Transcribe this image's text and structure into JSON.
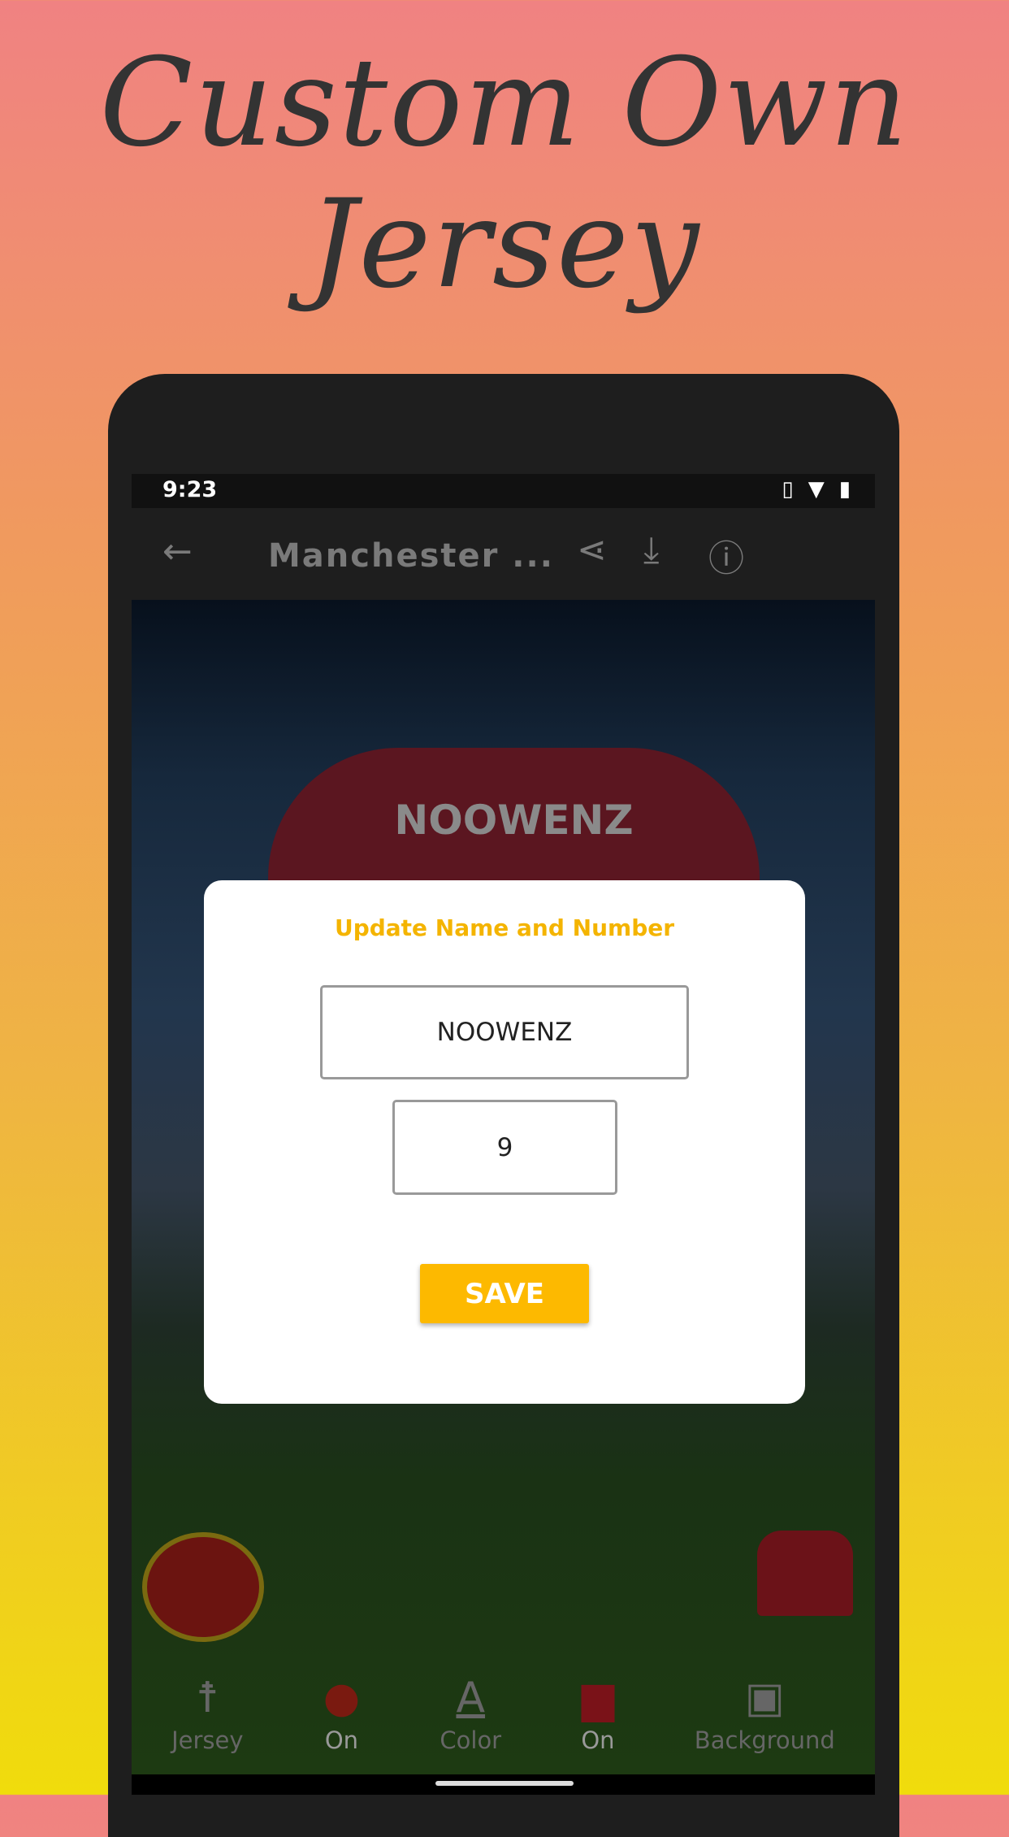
{
  "promo": {
    "headline": "Custom Own Jersey"
  },
  "status_bar": {
    "time": "9:23",
    "icons": [
      "vibrate-icon",
      "wifi-icon",
      "battery-charging-icon"
    ]
  },
  "app_bar": {
    "title": "Manchester ...",
    "actions": [
      "share-icon",
      "download-icon",
      "info-icon"
    ]
  },
  "canvas": {
    "jersey_name": "NOOWENZ"
  },
  "dialog": {
    "title": "Update Name and Number",
    "name_value": "NOOWENZ",
    "number_value": "9",
    "save_label": "SAVE"
  },
  "bottom_nav": [
    {
      "label": "Jersey",
      "icon": "person-icon"
    },
    {
      "label": "On",
      "icon": "club-crest-icon"
    },
    {
      "label": "Color",
      "icon": "text-color-icon"
    },
    {
      "label": "On",
      "icon": "shirt-icon"
    },
    {
      "label": "Background",
      "icon": "image-icon"
    }
  ],
  "colors": {
    "accent": "#fdb900",
    "dialog_title": "#f4b400"
  }
}
